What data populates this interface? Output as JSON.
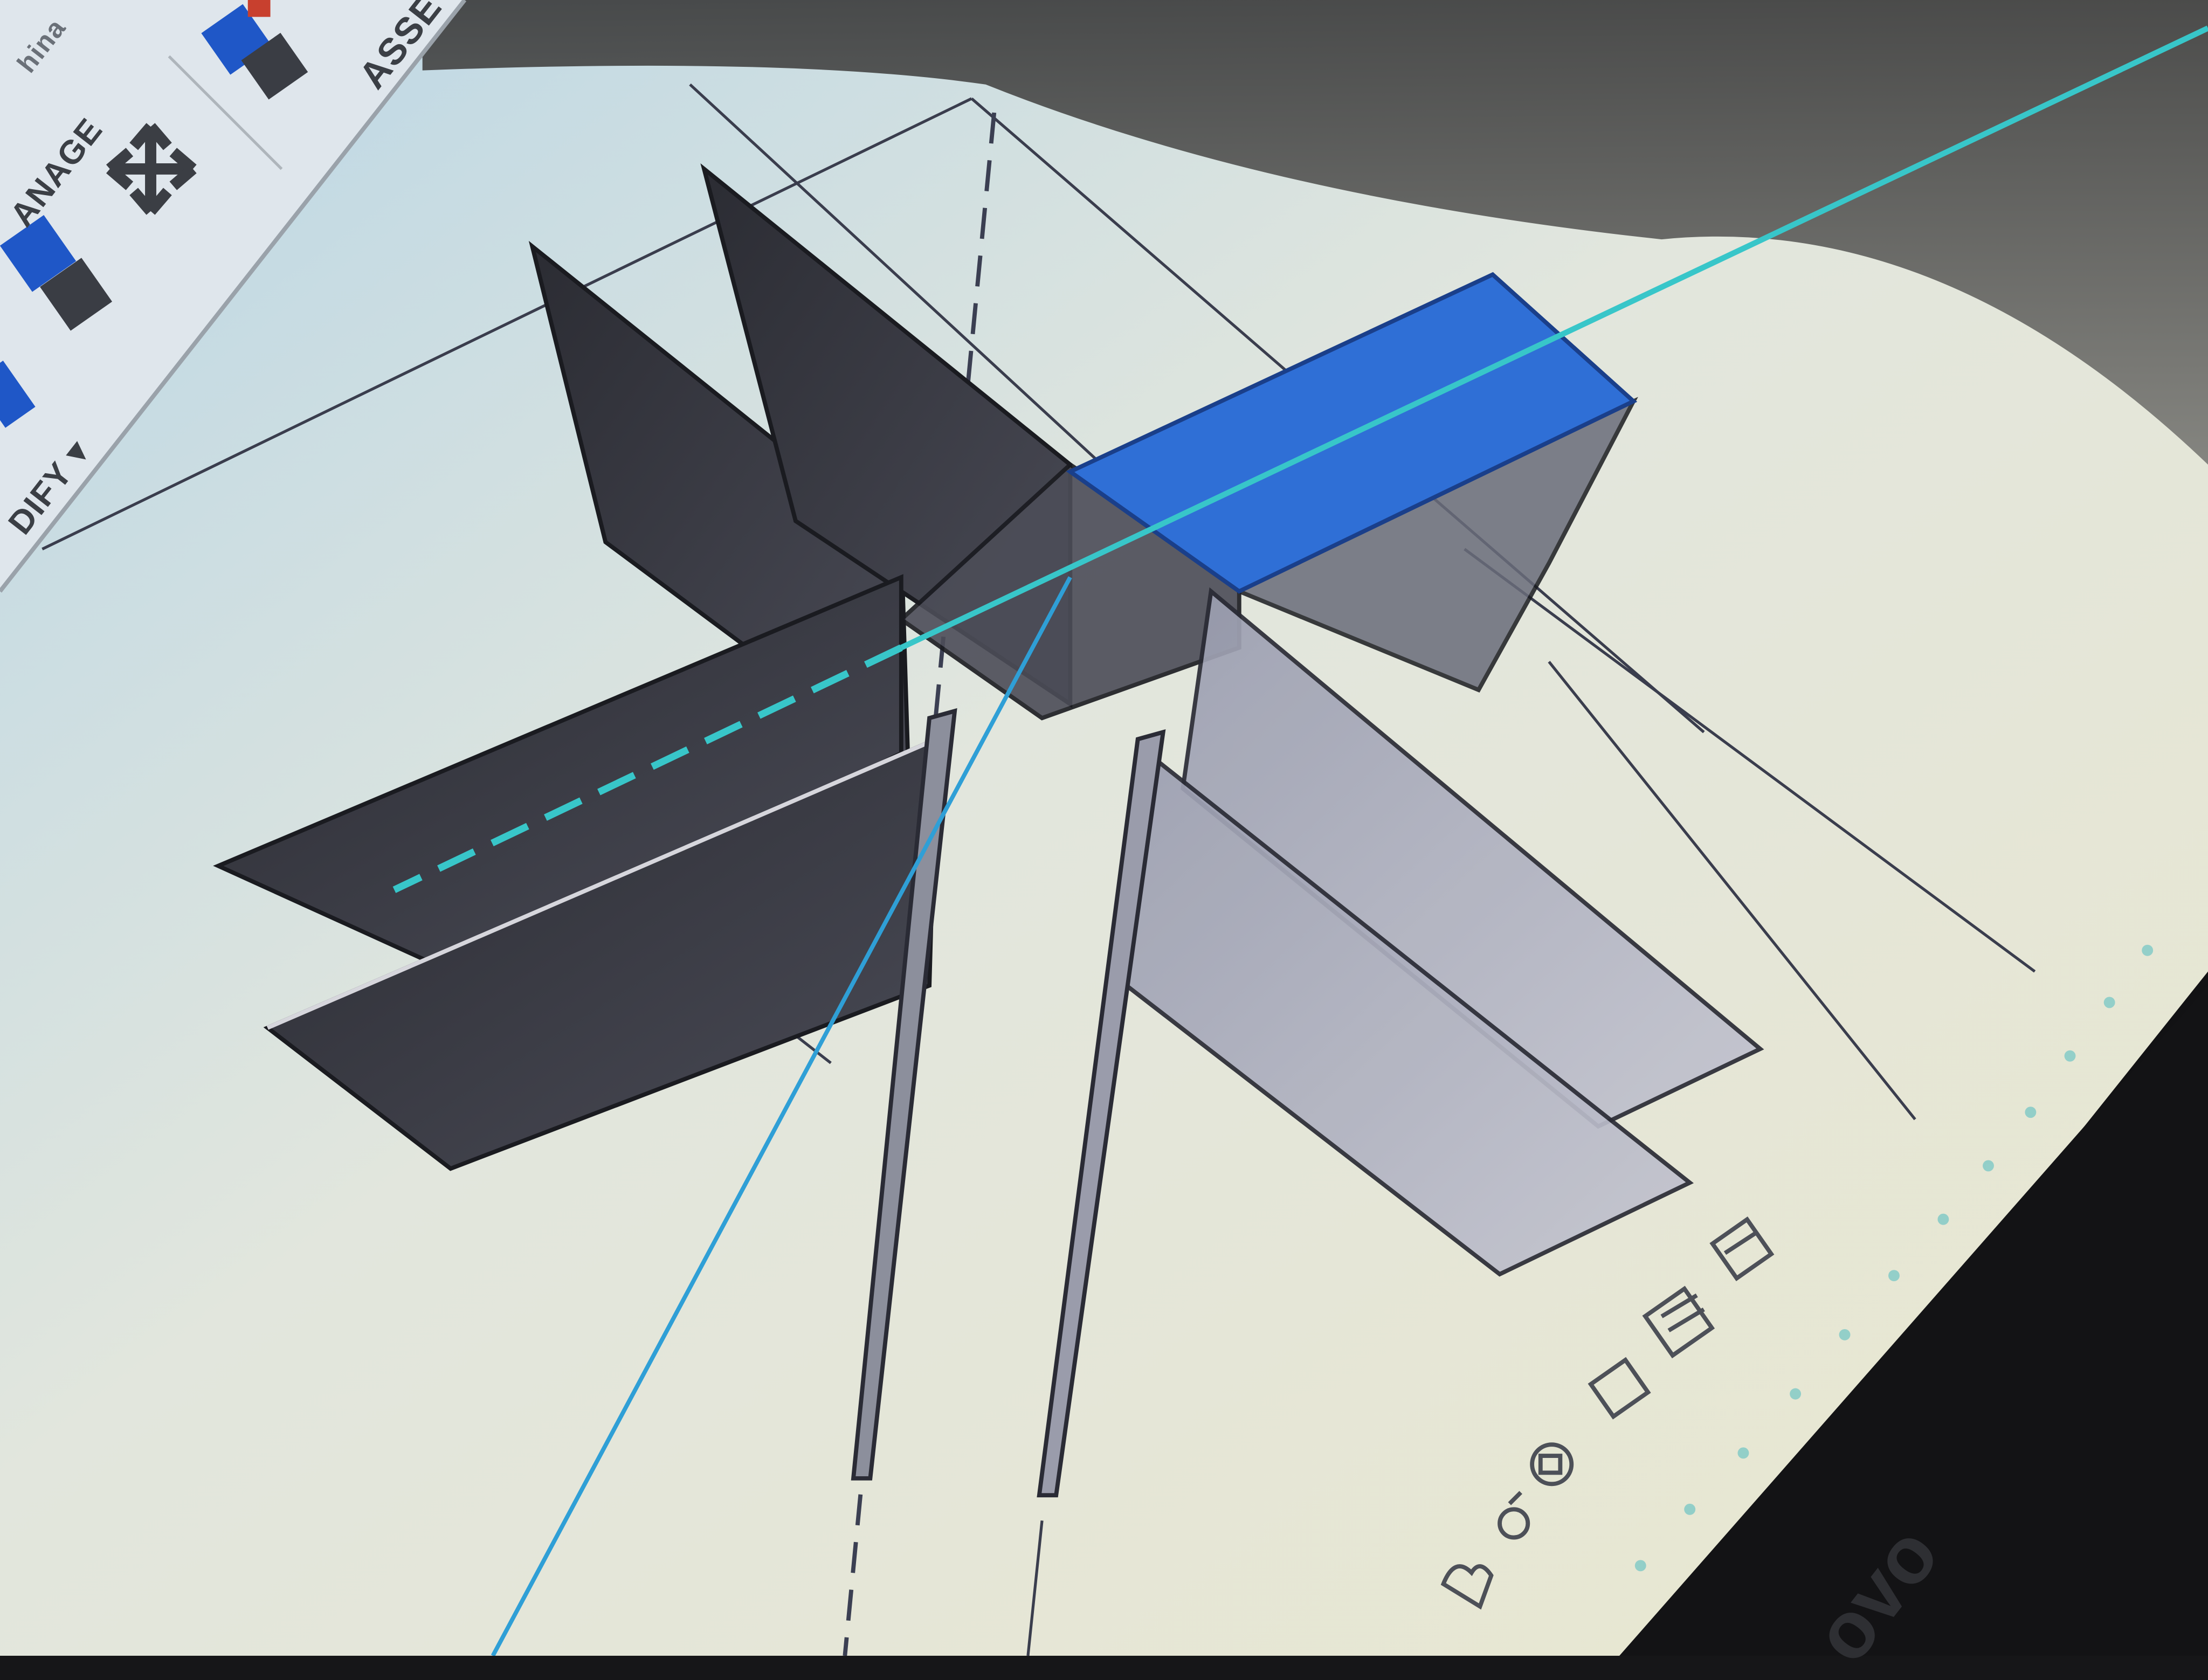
{
  "ribbon": {
    "tabs": [
      {
        "label": "ASSE"
      },
      {
        "label": "ANAGE"
      },
      {
        "label": "DIFY ▾"
      }
    ],
    "partial_tab_top": "hina"
  },
  "nav_bar": {
    "tools": [
      {
        "icon": "pan-hand-icon"
      },
      {
        "icon": "look-around-icon"
      },
      {
        "icon": "orbit-icon"
      },
      {
        "icon": "fit-view-icon"
      },
      {
        "icon": "grid-display-icon"
      },
      {
        "icon": "viewcube-icon"
      }
    ]
  },
  "device": {
    "brand": "ovo"
  },
  "colors": {
    "canvas": "#e7e6d7",
    "selection_blue": "#2f6fd6",
    "wall_dark": "#2e2f36",
    "wall_light": "#8a8d9e",
    "guide_cyan": "#38c6c9"
  }
}
